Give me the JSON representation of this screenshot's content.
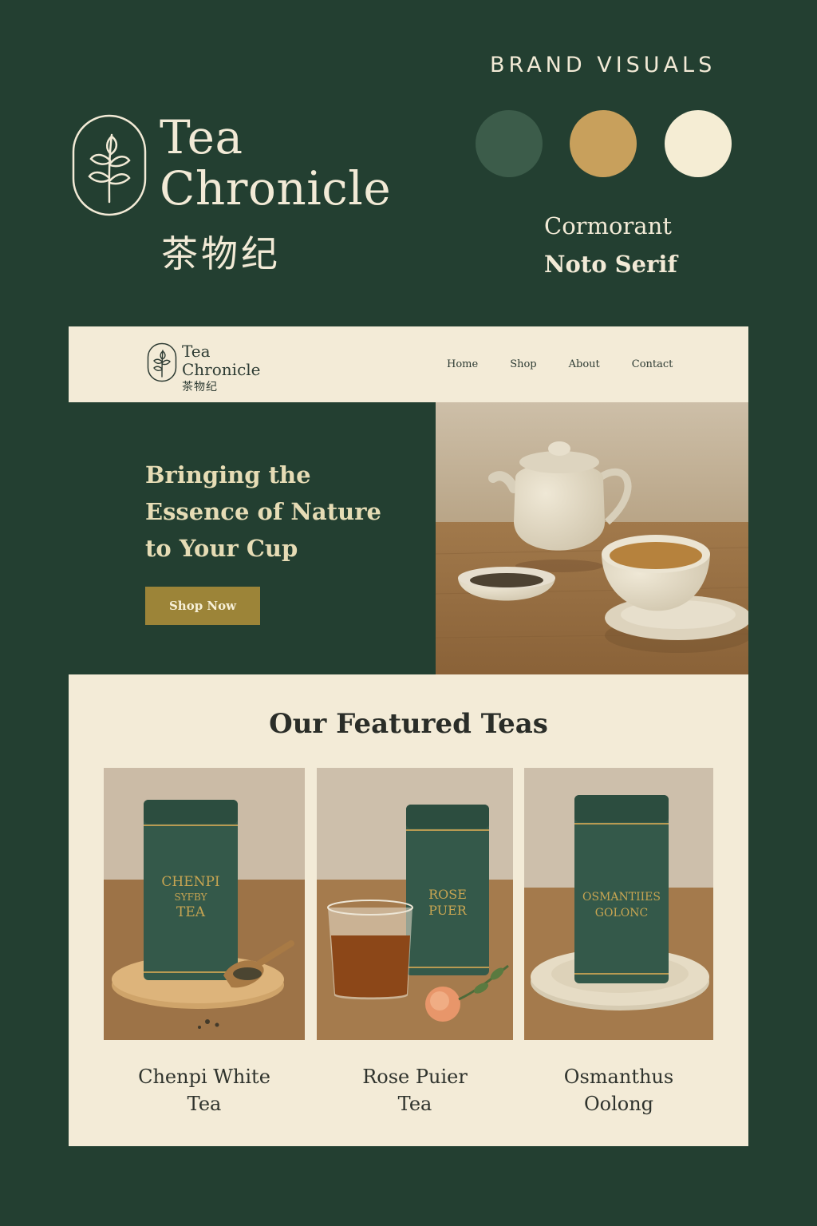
{
  "brand": {
    "name_line1": "Tea",
    "name_line2": "Chronicle",
    "chinese_name": "茶物纪",
    "logo_icon": "leaf-sprig-icon"
  },
  "brand_visuals": {
    "title": "BRAND VISUALS",
    "colors": [
      "#3c5c4a",
      "#c8a05c",
      "#f5edd4"
    ],
    "fonts": [
      "Cormorant",
      "Noto Serif"
    ]
  },
  "nav": {
    "logo_line1": "Tea",
    "logo_line2": "Chronicle",
    "logo_cn": "茶物纪",
    "links": [
      "Home",
      "Shop",
      "About",
      "Contact"
    ]
  },
  "hero": {
    "title_lines": [
      "Bringing the",
      "Essence of Nature",
      "to Your Cup"
    ],
    "cta_label": "Shop Now",
    "image": "teapot-and-cup-photo"
  },
  "featured": {
    "title": "Our Featured Teas",
    "products": [
      {
        "name_line1": "Chenpi White",
        "name_line2": "Tea",
        "tin_label": [
          "CHENPI",
          "SYFBY",
          "TEA"
        ],
        "image": "tea-tin-with-scoop-photo"
      },
      {
        "name_line1": "Rose Puier",
        "name_line2": "Tea",
        "tin_label": [
          "ROSE",
          "PUER"
        ],
        "image": "tea-tin-with-glass-and-rose-photo"
      },
      {
        "name_line1": "Osmanthus",
        "name_line2": "Oolong",
        "tin_label": [
          "OSMANTIIES",
          "GOLONC"
        ],
        "image": "tea-tin-on-plate-photo"
      }
    ]
  },
  "palette": {
    "background": "#233f31",
    "cream": "#f3ebd7",
    "gold": "#9c8438"
  }
}
